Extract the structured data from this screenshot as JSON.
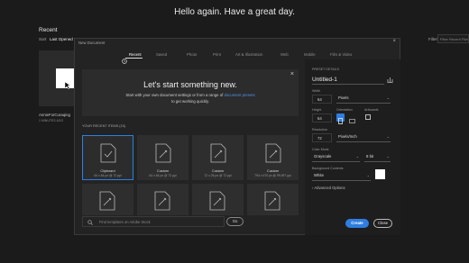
{
  "greeting": "Hello again. Have a great day.",
  "home": {
    "recent_heading": "Recent",
    "sort_label": "Sort",
    "sort_value": "Last Opened",
    "filter_label": "Filter",
    "filter_placeholder": "Filter Recent Files",
    "file_name": "AnnieForCuraqing",
    "file_time": "1 MINUTES AGO"
  },
  "dialog": {
    "title": "New Document",
    "tabs": [
      "Recent",
      "Saved",
      "Photo",
      "Print",
      "Art & Illustration",
      "Web",
      "Mobile",
      "Film & Video"
    ],
    "active_tab": "Recent",
    "welcome": {
      "title": "Let's start something new.",
      "line1_prefix": "Start with your own document settings or from a range of ",
      "line1_link": "document presets",
      "line2": "to get working quickly."
    },
    "recent_items_label": "YOUR RECENT ITEMS  (15)",
    "tiles": [
      {
        "name": "Clipboard",
        "size": "64 x 64 px @ 72 ppi",
        "selected": true
      },
      {
        "name": "Custom",
        "size": "64 x 64 px @ 72 ppi",
        "selected": false
      },
      {
        "name": "Custom",
        "size": "72 x 26 px @ 72 ppi",
        "selected": false
      },
      {
        "name": "Custom",
        "size": "794 x 670 px @ 99,997 ppi",
        "selected": false
      }
    ],
    "search_placeholder": "Find templates on Adobe Stock",
    "go_label": "Go"
  },
  "preset": {
    "section_label": "PRESET DETAILS",
    "name": "Untitled-1",
    "width_label": "Width",
    "width_value": "64",
    "width_unit": "Pixels",
    "height_label": "Height",
    "height_value": "64",
    "orientation_label": "Orientation",
    "artboards_label": "Artboards",
    "resolution_label": "Resolution",
    "resolution_value": "72",
    "resolution_unit": "Pixels/Inch",
    "color_mode_label": "Color Mode",
    "color_mode_value": "Grayscale",
    "bit_depth": "8 bit",
    "bg_label": "Background Contents",
    "bg_value": "White",
    "advanced_label": "Advanced Options",
    "create_label": "Create",
    "close_label": "Close"
  },
  "colors": {
    "accent": "#2f7ee0",
    "link": "#4f93ea",
    "dialog_bg": "#232323",
    "page_bg": "#1b1b1b"
  }
}
